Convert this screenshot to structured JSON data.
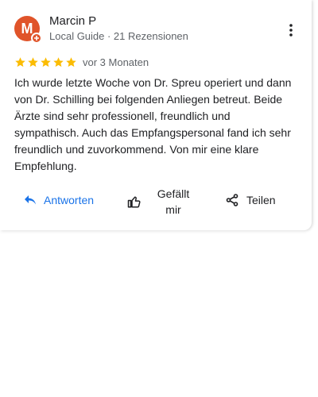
{
  "review": {
    "author": {
      "initial": "M",
      "name": "Marcin P",
      "meta": "Local Guide · 21 Rezensionen"
    },
    "rating": 5,
    "time_ago": "vor 3 Monaten",
    "text": "Ich wurde letzte Woche von Dr. Spreu operiert und dann von Dr. Schilling bei folgenden Anliegen betreut. Beide Ärzte sind sehr professionell, freundlich und sympathisch. Auch das Empfangspersonal fand ich sehr freundlich und zuvorkommend. Von mir eine klare Empfehlung."
  },
  "actions": {
    "reply_label": "Antworten",
    "like_label": "Gefällt\nmir",
    "share_label": "Teilen"
  },
  "icons": {
    "more": "more-vert-icon",
    "star": "star-icon",
    "reply": "reply-arrow-icon",
    "like": "thumb-up-icon",
    "share": "share-icon"
  },
  "colors": {
    "avatar": "#e0542a",
    "star": "#fbbc04",
    "reply_accent": "#1a73e8",
    "meta_text": "#5f6368"
  }
}
